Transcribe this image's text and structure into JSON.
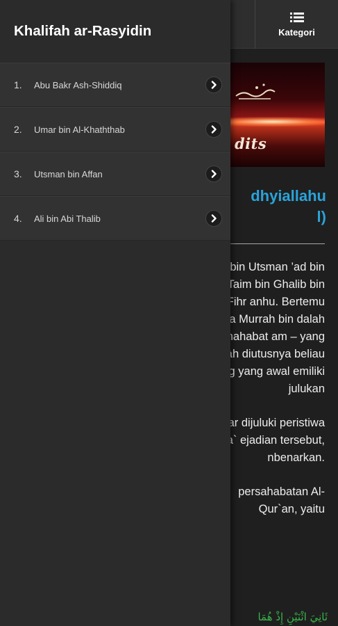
{
  "drawer": {
    "title": "Khalifah ar-Rasyidin",
    "items": [
      {
        "num": "1.",
        "label": "Abu Bakr Ash-Shiddiq"
      },
      {
        "num": "2.",
        "label": "Umar bin Al-Khaththab"
      },
      {
        "num": "3.",
        "label": "Utsman bin Affan"
      },
      {
        "num": "4.",
        "label": "Ali bin Abi Thalib"
      }
    ]
  },
  "topbar": {
    "kategori_label": "Kategori",
    "kategori_icon": "list-icon"
  },
  "banner": {
    "text": "dits"
  },
  "article": {
    "title_line1": "dhyiallahu",
    "title_line2": "l)",
    "paragraph1": "llah bin Utsman ’ad bin Taim bin Ghalib bin Fihr anhu. Bertemu knya Murrah bin dalah shahabat am – yang telah diutusnya beliau rang yang awal emiliki julukan",
    "paragraph2": "Bakar dijuluki peristiwa isra` ejadian tersebut, nbenarkan.",
    "paragraph3": "persahabatan Al-Qur`an, yaitu",
    "arabic": "ثَانِيَ اثْنَيْنِ إِذْ هُمَا"
  },
  "colors": {
    "title_accent": "#2aa3d9",
    "drawer_bg": "#2b2b2b",
    "item_bg": "#323232",
    "arabic_green": "#39b54a"
  }
}
